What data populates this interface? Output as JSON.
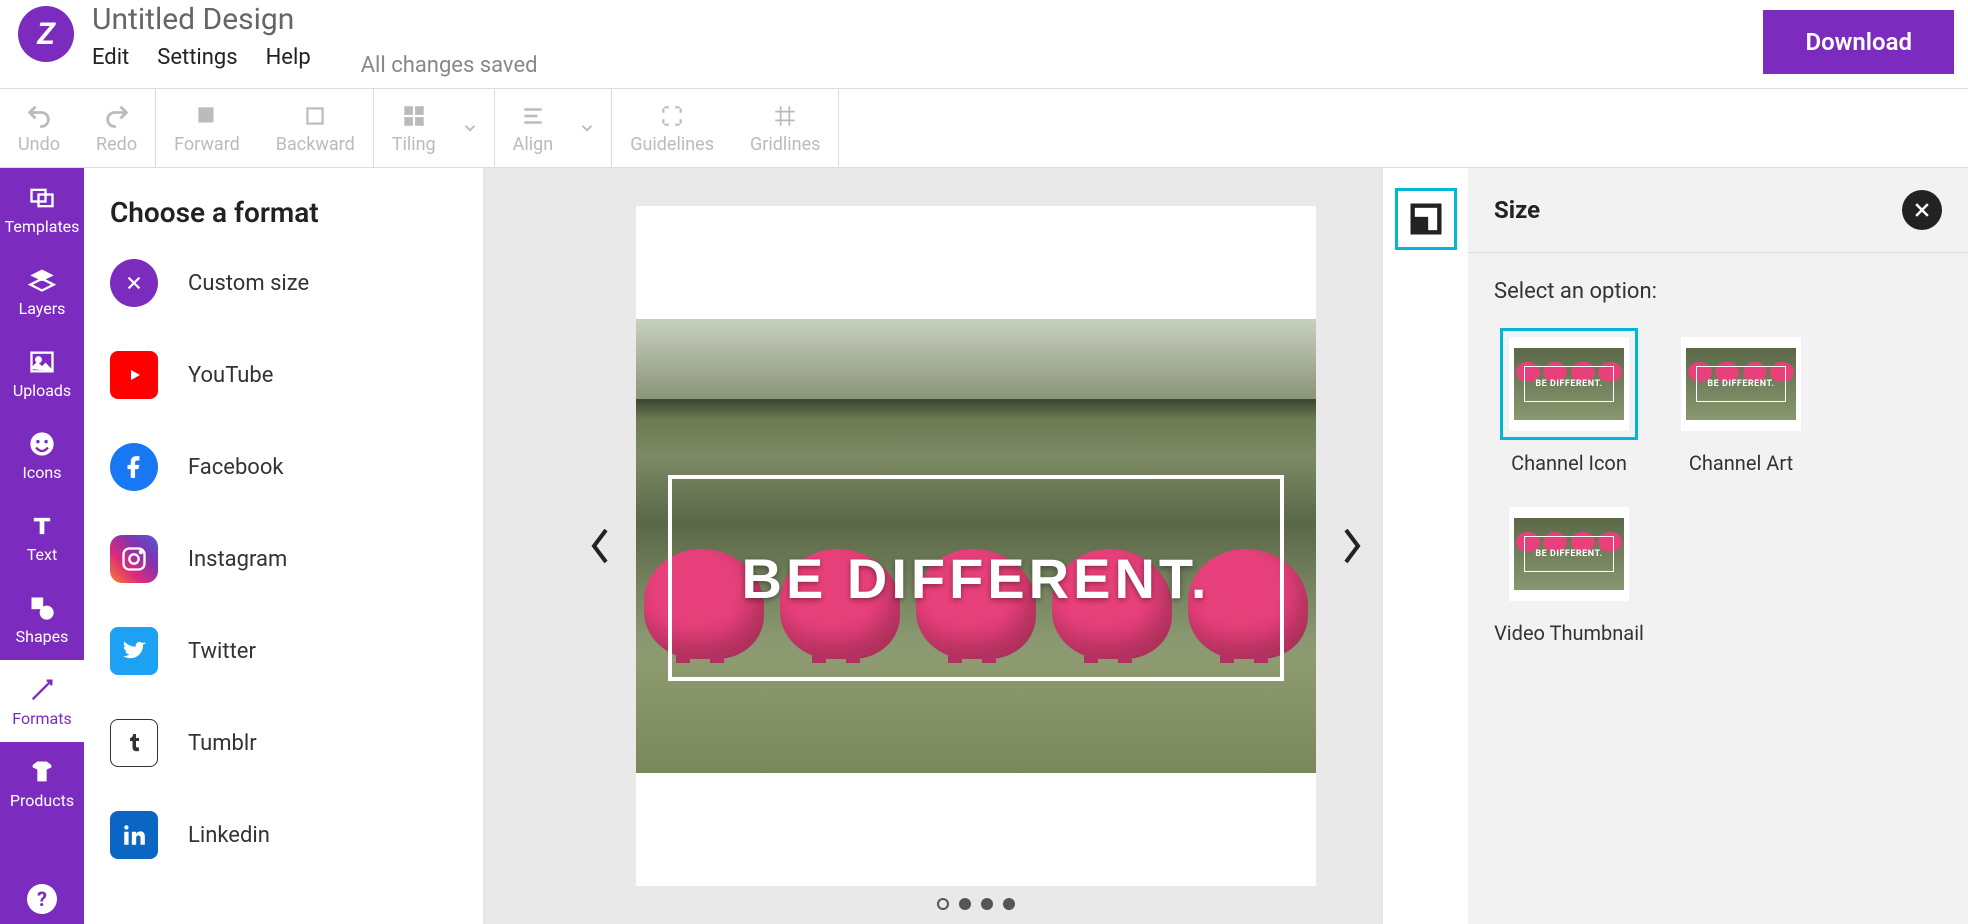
{
  "header": {
    "doc_title": "Untitled Design",
    "menu": {
      "edit": "Edit",
      "settings": "Settings",
      "help": "Help"
    },
    "saved": "All changes saved",
    "download": "Download"
  },
  "toolbar": {
    "undo": "Undo",
    "redo": "Redo",
    "forward": "Forward",
    "backward": "Backward",
    "tiling": "Tiling",
    "align": "Align",
    "guidelines": "Guidelines",
    "gridlines": "Gridlines"
  },
  "sidebar": {
    "items": [
      {
        "label": "Templates"
      },
      {
        "label": "Layers"
      },
      {
        "label": "Uploads"
      },
      {
        "label": "Icons"
      },
      {
        "label": "Text"
      },
      {
        "label": "Shapes"
      },
      {
        "label": "Formats"
      },
      {
        "label": "Products"
      }
    ]
  },
  "format_panel": {
    "title": "Choose a format",
    "items": [
      {
        "label": "Custom size"
      },
      {
        "label": "YouTube"
      },
      {
        "label": "Facebook"
      },
      {
        "label": "Instagram"
      },
      {
        "label": "Twitter"
      },
      {
        "label": "Tumblr"
      },
      {
        "label": "Linkedin"
      }
    ]
  },
  "canvas": {
    "text": "BE DIFFERENT.",
    "thumb_text": "BE DIFFERENT."
  },
  "size_panel": {
    "title": "Size",
    "prompt": "Select an option:",
    "options": [
      {
        "label": "Channel Icon"
      },
      {
        "label": "Channel Art"
      },
      {
        "label": "Video Thumbnail"
      }
    ]
  }
}
